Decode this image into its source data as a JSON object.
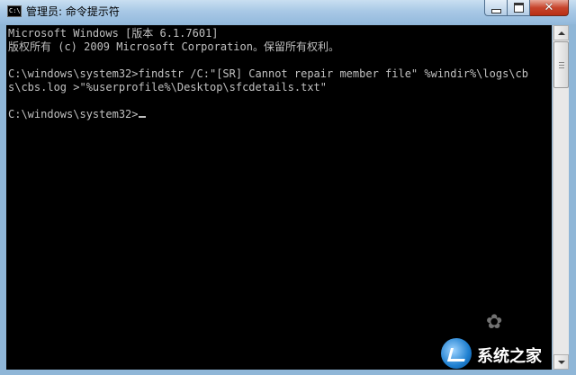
{
  "window": {
    "title": "管理员: 命令提示符",
    "icon_text": "C:\\"
  },
  "controls": {
    "minimize": "minimize-icon",
    "maximize": "maximize-icon",
    "close": "✕"
  },
  "console": {
    "lines": [
      "Microsoft Windows [版本 6.1.7601]",
      "版权所有 (c) 2009 Microsoft Corporation。保留所有权利。",
      "C:\\windows\\system32>findstr /C:\"[SR] Cannot repair member file\" %windir%\\logs\\cb",
      "s\\cbs.log >\"%userprofile%\\Desktop\\sfcdetails.txt\"",
      "C:\\windows\\system32>"
    ],
    "text_color": "#c0c0c0",
    "background": "#000000"
  },
  "watermark": {
    "text": "系统之家"
  }
}
